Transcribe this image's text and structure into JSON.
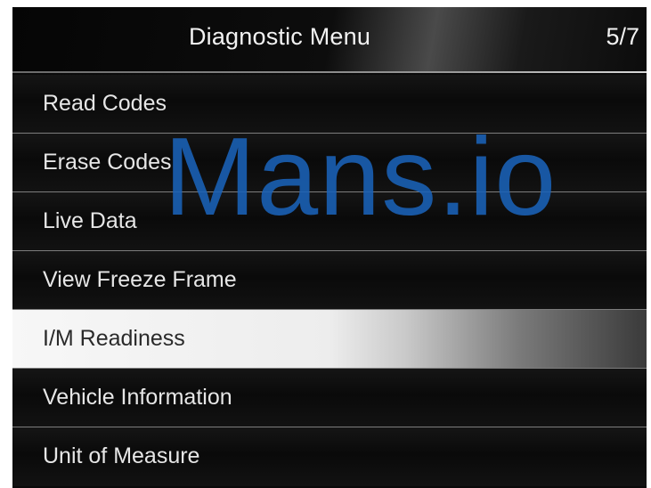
{
  "header": {
    "title": "Diagnostic Menu",
    "page_indicator": "5/7"
  },
  "menu": {
    "selected_index": 4,
    "items": [
      {
        "label": "Read Codes"
      },
      {
        "label": "Erase Codes"
      },
      {
        "label": "Live Data"
      },
      {
        "label": "View Freeze Frame"
      },
      {
        "label": "I/M Readiness"
      },
      {
        "label": "Vehicle Information"
      },
      {
        "label": "Unit of Measure"
      }
    ]
  },
  "watermark": {
    "text": "Mans.io"
  },
  "colors": {
    "screen_background": "#0a0a0a",
    "text": "#e6e6e6",
    "selected_background": "#f0f0f0",
    "selected_text": "#2a2a2a",
    "divider": "#7d7d7d",
    "watermark": "#1a62b8"
  }
}
